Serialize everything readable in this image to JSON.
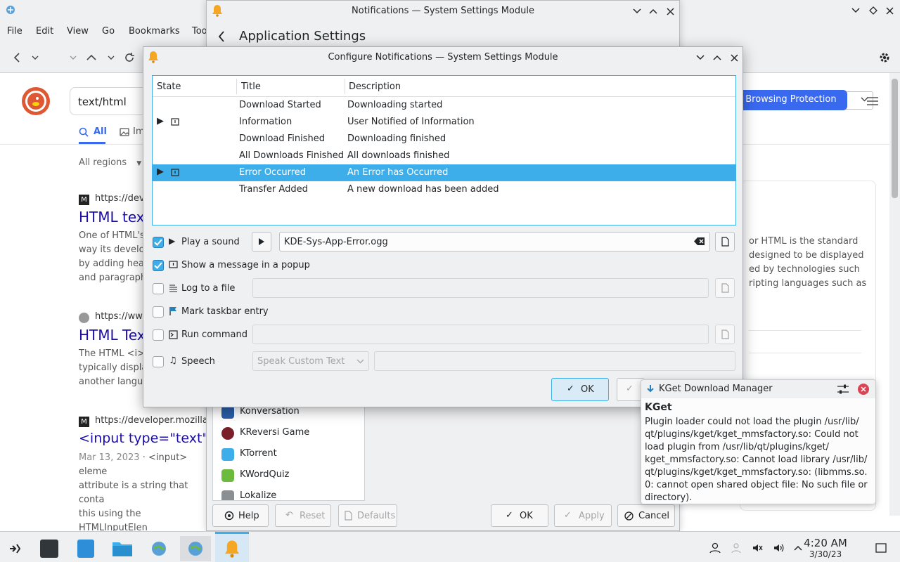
{
  "browser": {
    "menu": [
      "File",
      "Edit",
      "View",
      "Go",
      "Bookmarks",
      "Too"
    ],
    "search_query": "text/html",
    "tabs": {
      "all": "All",
      "images": "Im"
    },
    "region": "All regions",
    "protection_button": "et Browsing Protection",
    "results": [
      {
        "url": "https://dev",
        "title": "HTML text",
        "snippet": [
          "One of HTML's",
          "way its develo",
          "by adding hea",
          "and paragraph"
        ]
      },
      {
        "url": "https://ww",
        "title": "HTML Tex",
        "snippet": [
          "The HTML <i>",
          "typically displa",
          "another langu"
        ]
      },
      {
        "url": "https://developer.mozilla",
        "title": "<input type=\"text\"> -",
        "date": "Mar 13, 2023",
        "snippet": [
          "<input> eleme",
          "attribute is a string that conta",
          "this using the HTMLInputElen"
        ]
      }
    ],
    "side_panel": [
      "or HTML is the standard",
      "designed to be displayed",
      "ed by technologies such",
      "ripting languages such as"
    ]
  },
  "notif_window": {
    "title": "Notifications — System Settings Module",
    "heading": "Application Settings",
    "apps": [
      "Konversation",
      "KReversi Game",
      "KTorrent",
      "KWordQuiz",
      "Lokalize"
    ],
    "buttons": {
      "help": "Help",
      "reset": "Reset",
      "defaults": "Defaults",
      "ok": "OK",
      "apply": "Apply",
      "cancel": "Cancel"
    }
  },
  "dialog": {
    "title": "Configure Notifications — System Settings Module",
    "columns": {
      "state": "State",
      "title": "Title",
      "description": "Description"
    },
    "events": [
      {
        "title": "Download Started",
        "description": "Downloading started",
        "has_state": false,
        "selected": false
      },
      {
        "title": "Information",
        "description": "User Notified of Information",
        "has_state": true,
        "selected": false
      },
      {
        "title": "Download Finished",
        "description": "Downloading finished",
        "has_state": false,
        "selected": false
      },
      {
        "title": "All Downloads Finished",
        "description": "All downloads finished",
        "has_state": false,
        "selected": false
      },
      {
        "title": "Error Occurred",
        "description": "An Error has Occurred",
        "has_state": true,
        "selected": true
      },
      {
        "title": "Transfer Added",
        "description": "A new download has been added",
        "has_state": false,
        "selected": false
      }
    ],
    "options": {
      "play_sound": {
        "label": "Play a sound",
        "checked": true,
        "value": "KDE-Sys-App-Error.ogg"
      },
      "popup": {
        "label": "Show a message in a popup",
        "checked": true
      },
      "log_file": {
        "label": "Log to a file",
        "checked": false
      },
      "taskbar": {
        "label": "Mark taskbar entry",
        "checked": false
      },
      "run_command": {
        "label": "Run command",
        "checked": false
      },
      "speech": {
        "label": "Speech",
        "checked": false,
        "select_value": "Speak Custom Text"
      }
    },
    "ok_label": "OK"
  },
  "kget_popup": {
    "header": "KGet Download Manager",
    "app_name": "KGet",
    "lines": [
      "Plugin loader could not load the plugin /usr/lib/",
      "qt/plugins/kget/kget_mmsfactory.so: Could not",
      "load plugin from /usr/lib/qt/plugins/kget/",
      "kget_mmsfactory.so: Cannot load library /usr/lib/",
      "qt/plugins/kget/kget_mmsfactory.so: (libmms.so.",
      "0: cannot open shared object file: No such file or",
      "directory)."
    ]
  },
  "taskbar": {
    "time": "4:20 AM",
    "date": "3/30/23"
  },
  "colors": {
    "accent": "#3daee9",
    "ddg_orange": "#de5833",
    "link": "#1a0dab",
    "bell": "#f5a623"
  }
}
